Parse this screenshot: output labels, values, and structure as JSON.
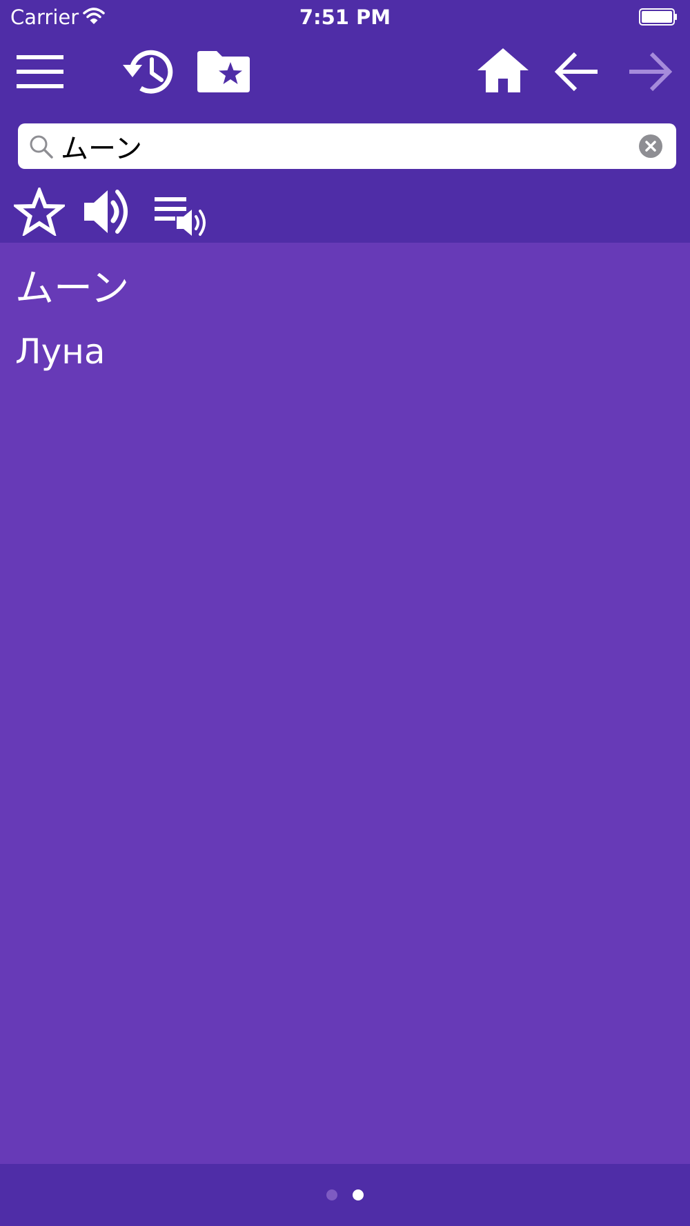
{
  "status_bar": {
    "carrier": "Carrier",
    "time": "7:51 PM"
  },
  "toolbar": {
    "icons": [
      "menu-icon",
      "history-icon",
      "favorites-folder-icon",
      "home-icon",
      "back-arrow-icon",
      "forward-arrow-icon"
    ]
  },
  "search": {
    "query": "ムーン",
    "placeholder": ""
  },
  "actions": {
    "icons": [
      "star-icon",
      "speaker-icon",
      "speak-list-icon"
    ]
  },
  "result": {
    "term": "ムーン",
    "translation": "Луна"
  },
  "pager": {
    "count": 2,
    "active_index": 1
  },
  "colors": {
    "header": "#4F2DA7",
    "background": "#673AB7",
    "foreground": "#FFFFFF",
    "disabled": "#A68BDB",
    "inactive_dot": "#7E5BC2"
  }
}
